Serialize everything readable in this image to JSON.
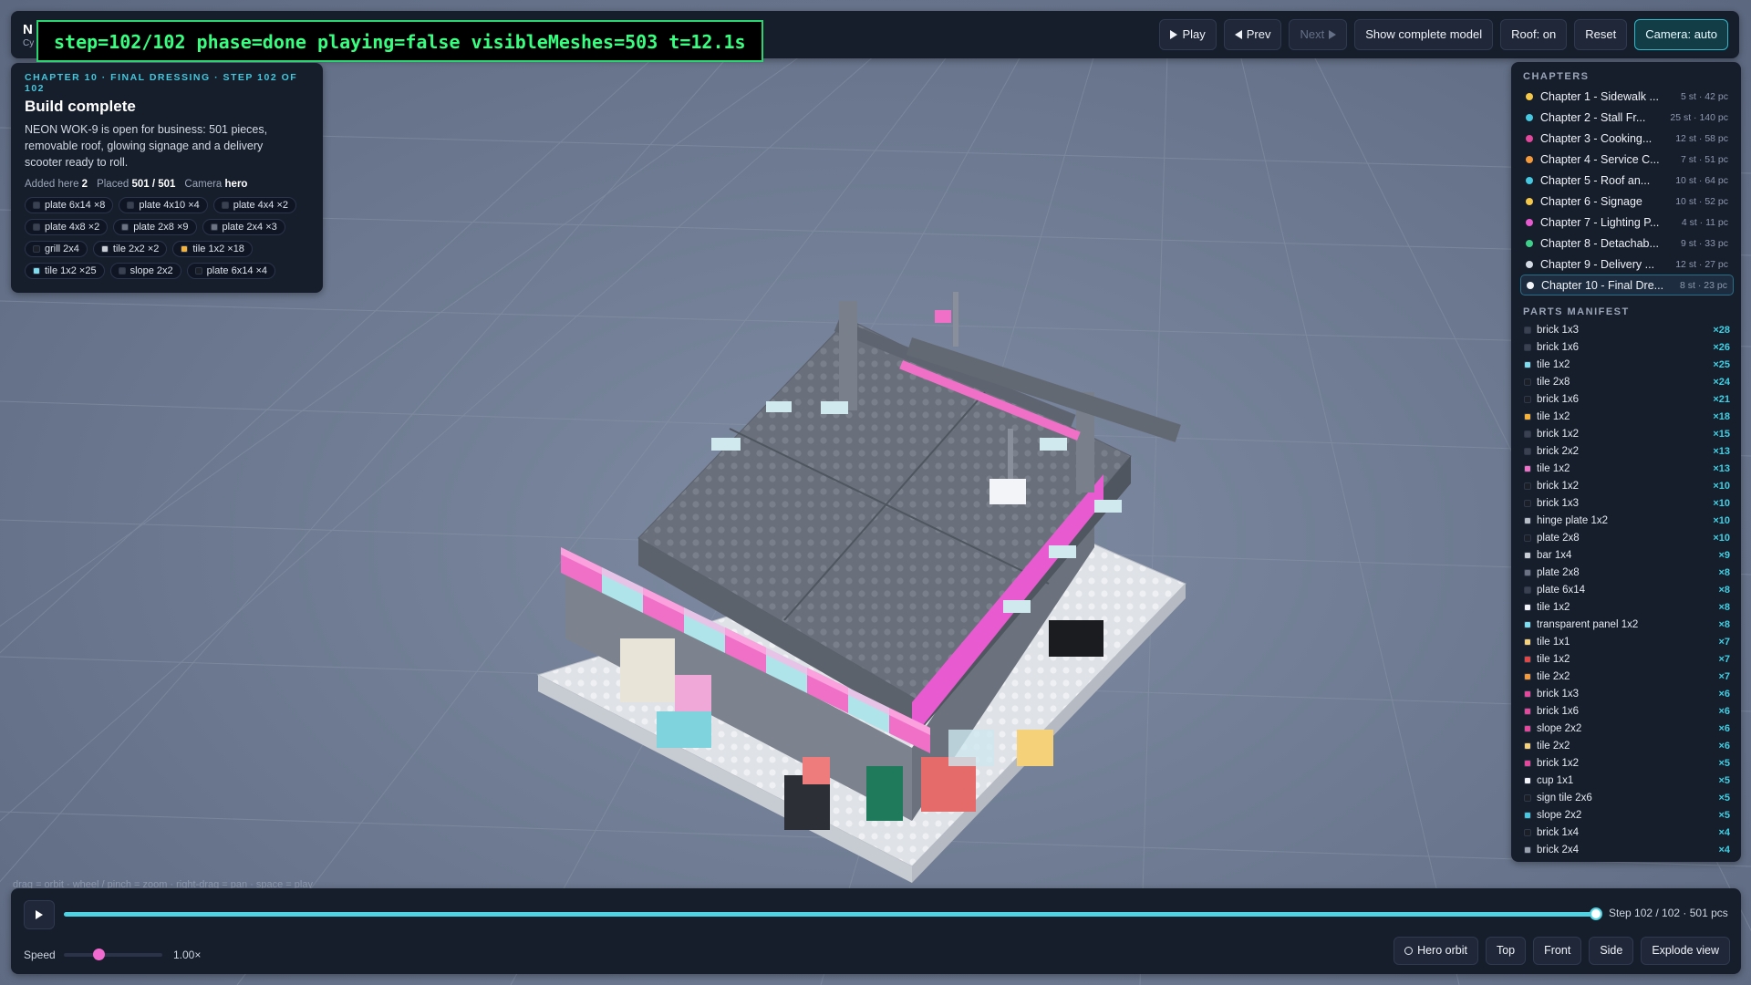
{
  "app": {
    "title": "N",
    "subtitle": "Cy"
  },
  "debug": {
    "text": "step=102/102 phase=done playing=false visibleMeshes=503 t=12.1s"
  },
  "toolbar": {
    "play_label": "Play",
    "prev_label": "Prev",
    "next_label": "Next",
    "show_complete_label": "Show complete model",
    "roof_label": "Roof: on",
    "reset_label": "Reset",
    "camera_label": "Camera: auto"
  },
  "step": {
    "chapter_label": "CHAPTER 10 · FINAL DRESSING · STEP 102 OF 102",
    "title": "Build complete",
    "description": "NEON WOK-9 is open for business: 501 pieces, removable roof, glowing signage and a delivery scooter ready to roll.",
    "added_label": "Added here",
    "added_value": "2",
    "placed_label": "Placed",
    "placed_value": "501 / 501",
    "camera_label": "Camera",
    "camera_value": "hero",
    "chips": [
      {
        "label": "plate 6x14 ×8",
        "color": "#3a4150"
      },
      {
        "label": "plate 4x10 ×4",
        "color": "#3a4150"
      },
      {
        "label": "plate 4x4 ×2",
        "color": "#3a4150"
      },
      {
        "label": "plate 4x8 ×2",
        "color": "#3a4150"
      },
      {
        "label": "plate 2x8 ×9",
        "color": "#6c7382"
      },
      {
        "label": "plate 2x4 ×3",
        "color": "#6c7382"
      },
      {
        "label": "grill 2x4",
        "color": "#1a1f28"
      },
      {
        "label": "tile 2x2 ×2",
        "color": "#c9ced6"
      },
      {
        "label": "tile 1x2 ×18",
        "color": "#f5b23a"
      },
      {
        "label": "tile 1x2 ×25",
        "color": "#7fdcef"
      },
      {
        "label": "slope 2x2",
        "color": "#3a4150"
      },
      {
        "label": "plate 6x14 ×4",
        "color": "#1a1f28"
      }
    ]
  },
  "sidebar": {
    "chapters_heading": "CHAPTERS",
    "chapters": [
      {
        "name": "Chapter 1 - Sidewalk ...",
        "meta": "5 st · 42 pc",
        "color": "#f5c84a"
      },
      {
        "name": "Chapter 2 - Stall Fr...",
        "meta": "25 st · 140 pc",
        "color": "#45c8e0"
      },
      {
        "name": "Chapter 3 - Cooking...",
        "meta": "12 st · 58 pc",
        "color": "#e4489c"
      },
      {
        "name": "Chapter 4 - Service C...",
        "meta": "7 st · 51 pc",
        "color": "#f59a3a"
      },
      {
        "name": "Chapter 5 - Roof an...",
        "meta": "10 st · 64 pc",
        "color": "#45c8e0"
      },
      {
        "name": "Chapter 6 - Signage",
        "meta": "10 st · 52 pc",
        "color": "#f5c84a"
      },
      {
        "name": "Chapter 7 - Lighting P...",
        "meta": "4 st · 11 pc",
        "color": "#e85ad0"
      },
      {
        "name": "Chapter 8 - Detachab...",
        "meta": "9 st · 33 pc",
        "color": "#3ed08a"
      },
      {
        "name": "Chapter 9 - Delivery ...",
        "meta": "12 st · 27 pc",
        "color": "#d5dbe4"
      },
      {
        "name": "Chapter 10 - Final Dre...",
        "meta": "8 st · 23 pc",
        "color": "#f2f4f7"
      }
    ],
    "manifest_heading": "PARTS MANIFEST",
    "parts": [
      {
        "name": "brick 1x3",
        "count": "×28",
        "color": "#3a4150"
      },
      {
        "name": "brick 1x6",
        "count": "×26",
        "color": "#3a4150"
      },
      {
        "name": "tile 1x2",
        "count": "×25",
        "color": "#7fdcef"
      },
      {
        "name": "tile 2x8",
        "count": "×24",
        "color": "#1a1f28"
      },
      {
        "name": "brick 1x6",
        "count": "×21",
        "color": "#1a1f28"
      },
      {
        "name": "tile 1x2",
        "count": "×18",
        "color": "#f5b23a"
      },
      {
        "name": "brick 1x2",
        "count": "×15",
        "color": "#3a4150"
      },
      {
        "name": "brick 2x2",
        "count": "×13",
        "color": "#3a4150"
      },
      {
        "name": "tile 1x2",
        "count": "×13",
        "color": "#f070c8"
      },
      {
        "name": "brick 1x2",
        "count": "×10",
        "color": "#1a1f28"
      },
      {
        "name": "brick 1x3",
        "count": "×10",
        "color": "#1a1f28"
      },
      {
        "name": "hinge plate 1x2",
        "count": "×10",
        "color": "#b8bec8"
      },
      {
        "name": "plate 2x8",
        "count": "×10",
        "color": "#1a1f28"
      },
      {
        "name": "bar 1x4",
        "count": "×9",
        "color": "#c9ced6"
      },
      {
        "name": "plate 2x8",
        "count": "×8",
        "color": "#6c7382"
      },
      {
        "name": "plate 6x14",
        "count": "×8",
        "color": "#3a4150"
      },
      {
        "name": "tile 1x2",
        "count": "×8",
        "color": "#f2f4f7"
      },
      {
        "name": "transparent panel 1x2",
        "count": "×8",
        "color": "#7fdcef"
      },
      {
        "name": "tile 1x1",
        "count": "×7",
        "color": "#f5d27a"
      },
      {
        "name": "tile 1x2",
        "count": "×7",
        "color": "#e04848"
      },
      {
        "name": "tile 2x2",
        "count": "×7",
        "color": "#f59a3a"
      },
      {
        "name": "brick 1x3",
        "count": "×6",
        "color": "#e4489c"
      },
      {
        "name": "brick 1x6",
        "count": "×6",
        "color": "#e4489c"
      },
      {
        "name": "slope 2x2",
        "count": "×6",
        "color": "#e4489c"
      },
      {
        "name": "tile 2x2",
        "count": "×6",
        "color": "#f5d27a"
      },
      {
        "name": "brick 1x2",
        "count": "×5",
        "color": "#e4489c"
      },
      {
        "name": "cup 1x1",
        "count": "×5",
        "color": "#f2f4f7"
      },
      {
        "name": "sign tile 2x6",
        "count": "×5",
        "color": "#1a1f28"
      },
      {
        "name": "slope 2x2",
        "count": "×5",
        "color": "#45c8e0"
      },
      {
        "name": "brick 1x4",
        "count": "×4",
        "color": "#1a1f28"
      },
      {
        "name": "brick 2x4",
        "count": "×4",
        "color": "#9aa2ae"
      }
    ]
  },
  "timeline": {
    "hint": "drag = orbit · wheel / pinch = zoom · right-drag = pan · space = play",
    "progress": 1.0,
    "readout": "Step 102 / 102 · 501 pcs",
    "speed_label": "Speed",
    "speed_fraction": 0.35,
    "speed_value": "1.00×",
    "views": {
      "hero": "Hero orbit",
      "top": "Top",
      "front": "Front",
      "side": "Side",
      "explode": "Explode view"
    }
  }
}
